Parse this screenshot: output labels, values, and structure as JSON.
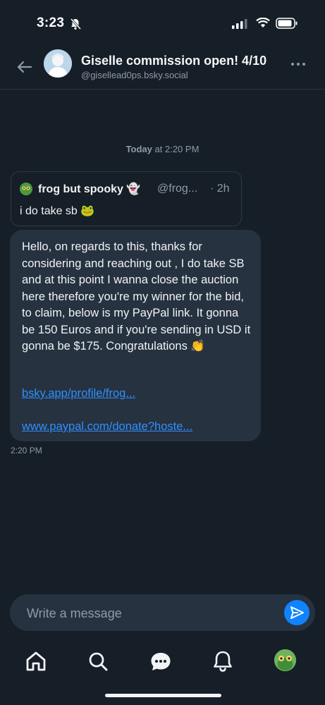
{
  "status": {
    "time": "3:23"
  },
  "header": {
    "title": "Giselle commission open! 4/10",
    "handle": "@gisellead0ps.bsky.social"
  },
  "date_sep": {
    "day": "Today",
    "time": "at 2:20 PM"
  },
  "quote": {
    "name": "frog but spooky 👻",
    "handle": "@frog...",
    "time": "· 2h",
    "text": "i do take sb 🐸"
  },
  "message": {
    "body": "Hello, on regards to this, thanks for considering and reaching out , I do take SB and at this point I wanna close the auction here therefore you're my winner for the bid, to claim, below is my PayPal link. It gonna be 150 Euros and if you're sending in USD it gonna be $175. Congratulations 👏",
    "link1": "bsky.app/profile/frog...",
    "link2": "www.paypal.com/donate?hoste...",
    "time": "2:20 PM"
  },
  "composer": {
    "placeholder": "Write a message"
  },
  "nav": {
    "items": [
      "home-icon",
      "search-icon",
      "chat-icon",
      "bell-icon",
      "profile-avatar"
    ]
  },
  "colors": {
    "accent": "#1083fe",
    "link": "#2f8fff",
    "bubble": "#263240",
    "background": "#161e27"
  }
}
